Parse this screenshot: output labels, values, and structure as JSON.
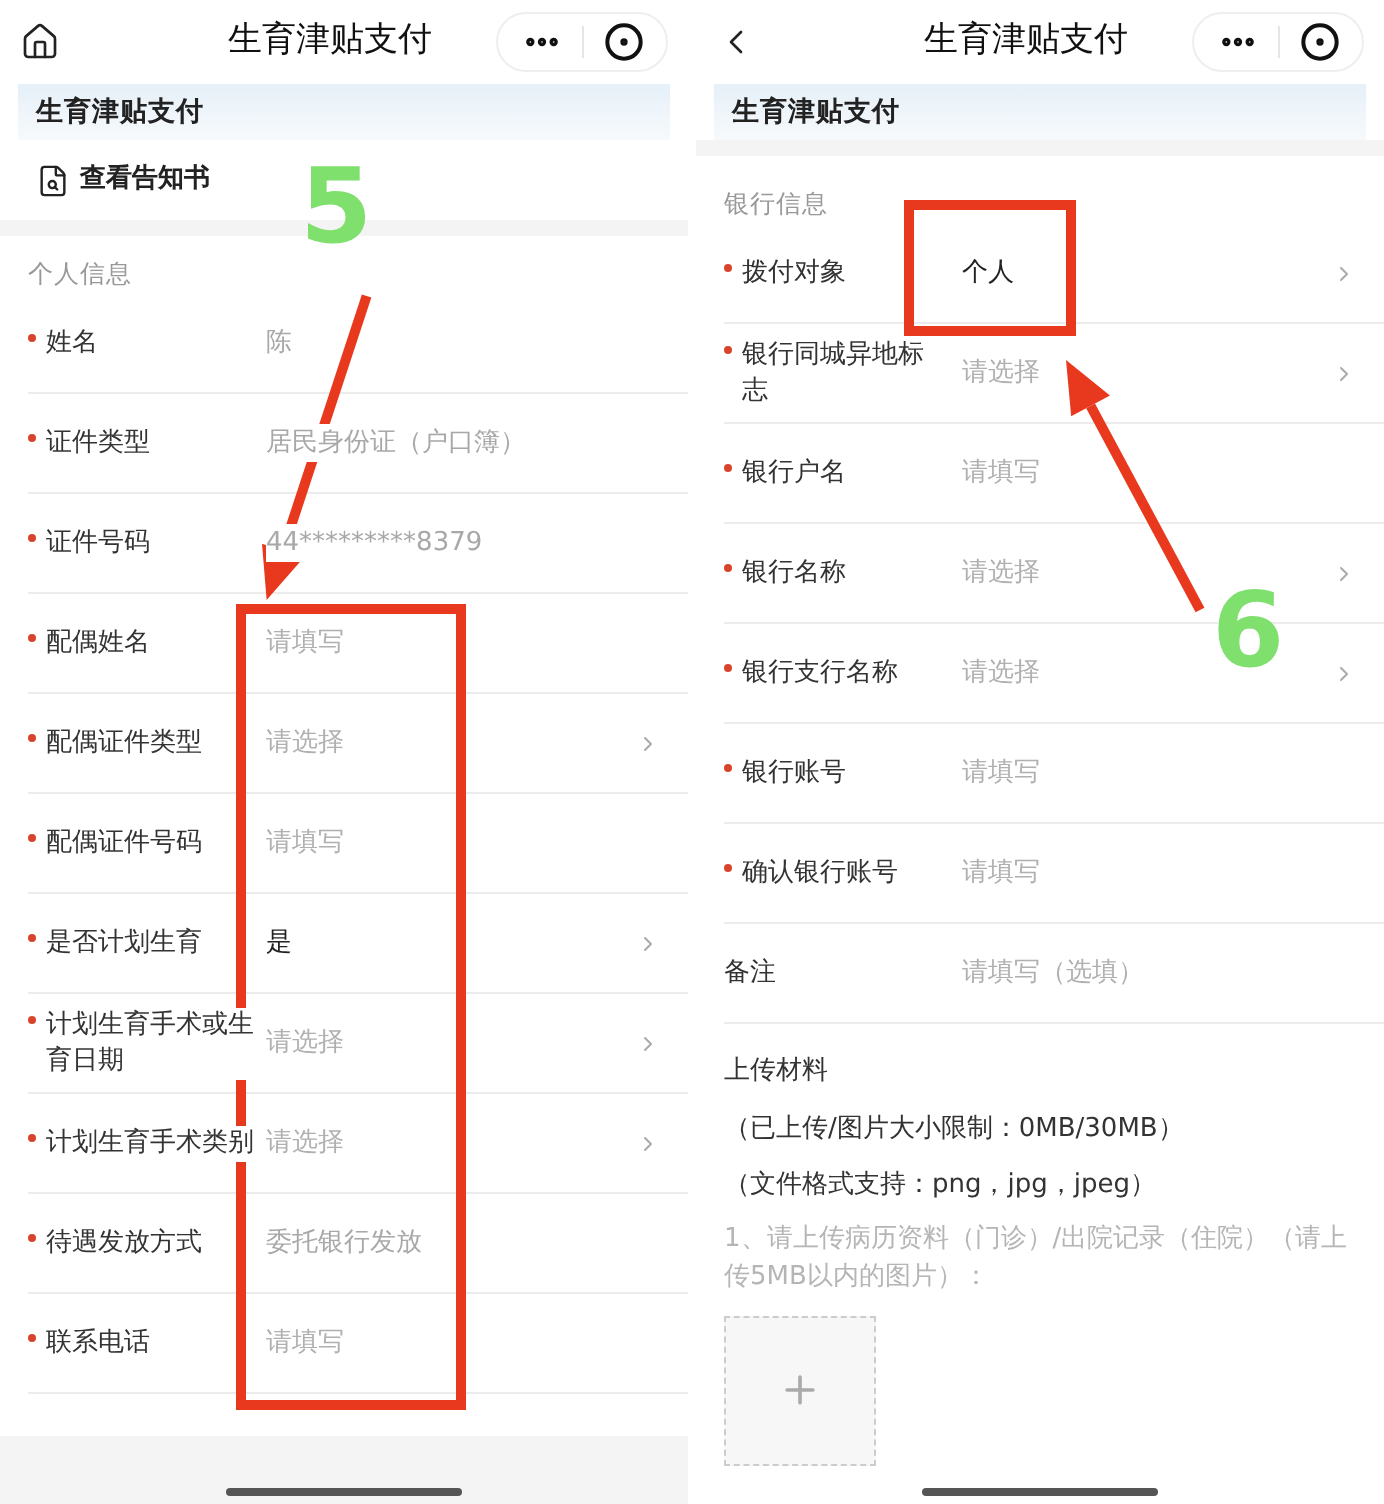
{
  "screens": [
    {
      "nav": {
        "title": "生育津贴支付"
      },
      "banner": "生育津贴支付",
      "notice_link": "查看告知书",
      "section": "个人信息",
      "rows": [
        {
          "label": "姓名",
          "required": true,
          "value": "陈",
          "muted": true,
          "chevron": false
        },
        {
          "label": "证件类型",
          "required": true,
          "value": "居民身份证（户口簿）",
          "muted": true,
          "chevron": false
        },
        {
          "label": "证件号码",
          "required": true,
          "value": "44*********8379",
          "muted": true,
          "chevron": false
        },
        {
          "label": "配偶姓名",
          "required": true,
          "placeholder": "请填写",
          "chevron": false
        },
        {
          "label": "配偶证件类型",
          "required": true,
          "placeholder": "请选择",
          "chevron": true
        },
        {
          "label": "配偶证件号码",
          "required": true,
          "placeholder": "请填写",
          "chevron": false
        },
        {
          "label": "是否计划生育",
          "required": true,
          "value": "是",
          "muted": false,
          "chevron": true
        },
        {
          "label": "计划生育手术或生育日期",
          "required": true,
          "placeholder": "请选择",
          "chevron": true
        },
        {
          "label": "计划生育手术类别",
          "required": true,
          "placeholder": "请选择",
          "chevron": true
        },
        {
          "label": "待遇发放方式",
          "required": true,
          "value": "委托银行发放",
          "muted": true,
          "chevron": false
        },
        {
          "label": "联系电话",
          "required": true,
          "placeholder": "请填写",
          "chevron": false
        }
      ],
      "annotation": {
        "step": "5"
      }
    },
    {
      "nav": {
        "title": "生育津贴支付"
      },
      "banner": "生育津贴支付",
      "section": "银行信息",
      "rows": [
        {
          "label": "拨付对象",
          "required": true,
          "value": "个人",
          "muted": false,
          "chevron": true
        },
        {
          "label": "银行同城异地标志",
          "required": true,
          "placeholder": "请选择",
          "chevron": true
        },
        {
          "label": "银行户名",
          "required": true,
          "placeholder": "请填写",
          "chevron": false
        },
        {
          "label": "银行名称",
          "required": true,
          "placeholder": "请选择",
          "chevron": true
        },
        {
          "label": "银行支行名称",
          "required": true,
          "placeholder": "请选择",
          "chevron": true
        },
        {
          "label": "银行账号",
          "required": true,
          "placeholder": "请填写",
          "chevron": false
        },
        {
          "label": "确认银行账号",
          "required": true,
          "placeholder": "请填写",
          "chevron": false
        },
        {
          "label": "备注",
          "required": false,
          "placeholder": "请填写（选填）",
          "chevron": false
        }
      ],
      "upload": {
        "title": "上传材料",
        "notes": [
          "（已上传/图片大小限制：0MB/30MB）",
          "（文件格式支持：png，jpg，jpeg）"
        ],
        "hint": "1、请上传病历资料（门诊）/出院记录（住院）（请上传5MB以内的图片）："
      },
      "annotation": {
        "step": "6"
      }
    }
  ]
}
